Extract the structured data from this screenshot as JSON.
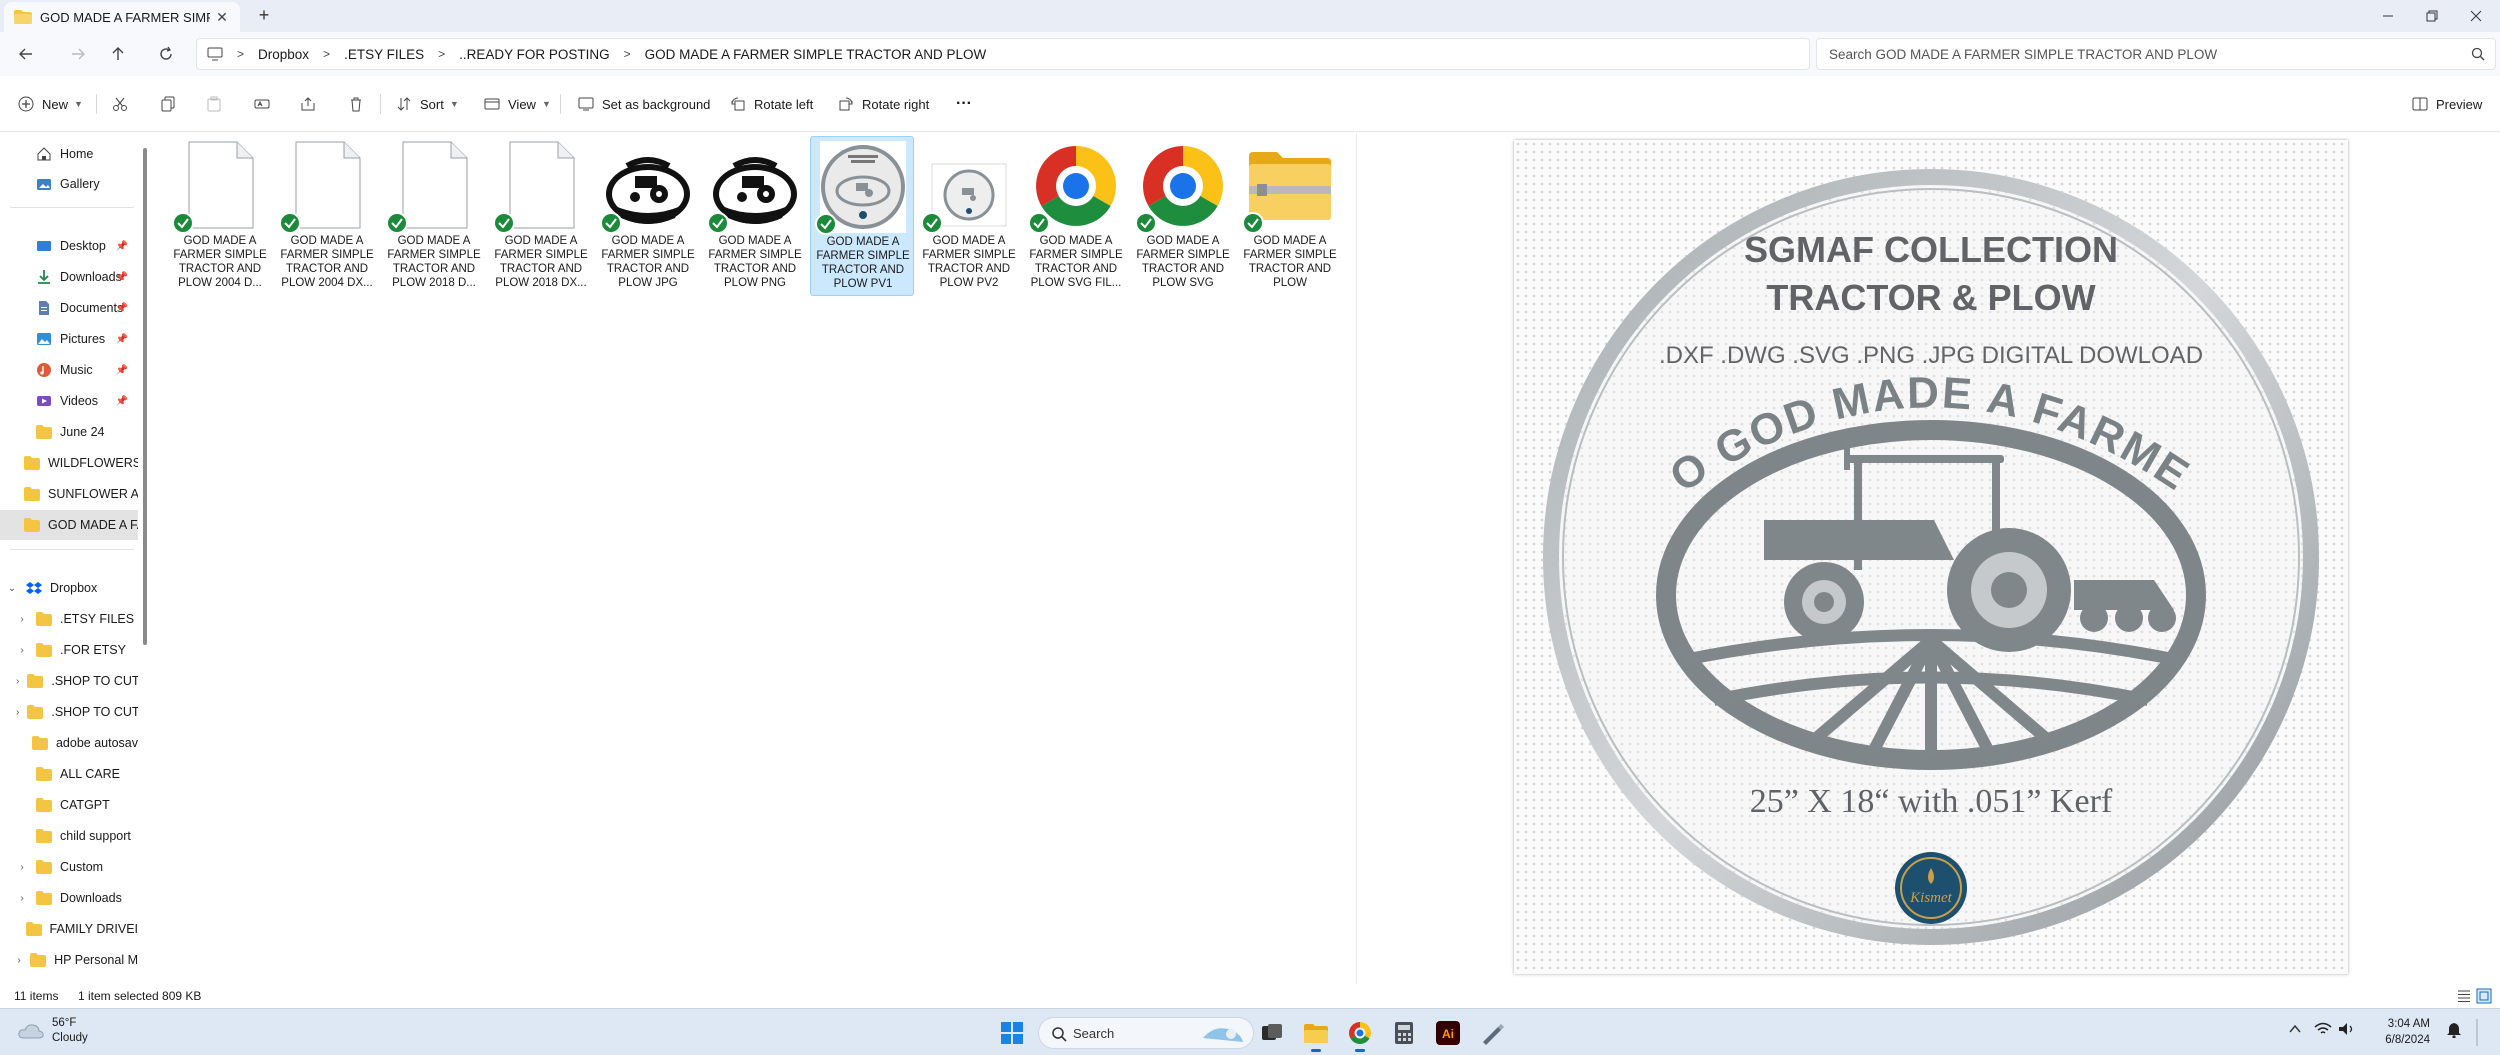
{
  "window": {
    "tab_title": "GOD MADE A FARMER SIMPLE",
    "new_tab": "+",
    "close": "✕"
  },
  "breadcrumbs": [
    "Dropbox",
    ".ETSY FILES",
    "..READY FOR POSTING",
    "GOD MADE A FARMER SIMPLE TRACTOR AND PLOW"
  ],
  "search": {
    "placeholder": "Search GOD MADE A FARMER SIMPLE TRACTOR AND PLOW"
  },
  "toolbar": {
    "new": "New",
    "sort": "Sort",
    "view": "View",
    "set_background": "Set as background",
    "rotate_left": "Rotate left",
    "rotate_right": "Rotate right",
    "more": "···",
    "preview": "Preview"
  },
  "sidebar": {
    "quick": [
      {
        "label": "Home",
        "icon": "home-icon"
      },
      {
        "label": "Gallery",
        "icon": "gallery-icon"
      }
    ],
    "pinned": [
      {
        "label": "Desktop",
        "icon": "desktop-icon",
        "pinned": true
      },
      {
        "label": "Downloads",
        "icon": "downloads-icon",
        "pinned": true
      },
      {
        "label": "Documents",
        "icon": "documents-icon",
        "pinned": true
      },
      {
        "label": "Pictures",
        "icon": "pictures-icon",
        "pinned": true
      },
      {
        "label": "Music",
        "icon": "music-icon",
        "pinned": true
      },
      {
        "label": "Videos",
        "icon": "videos-icon",
        "pinned": true
      },
      {
        "label": "June 24",
        "icon": "folder-icon",
        "pinned": false
      },
      {
        "label": "WILDFLOWERS I",
        "icon": "folder-icon",
        "pinned": false
      },
      {
        "label": "SUNFLOWER AL",
        "icon": "folder-icon",
        "pinned": false
      },
      {
        "label": "GOD MADE A FA",
        "icon": "folder-icon",
        "pinned": false,
        "selected": true
      }
    ],
    "dropbox_label": "Dropbox",
    "dropbox": [
      {
        "label": ".ETSY FILES",
        "expandable": true
      },
      {
        "label": ".FOR ETSY",
        "expandable": true
      },
      {
        "label": ".SHOP TO CUT",
        "expandable": true
      },
      {
        "label": ".SHOP TO CUT",
        "expandable": true
      },
      {
        "label": "adobe autosav",
        "expandable": false
      },
      {
        "label": "ALL CARE",
        "expandable": false
      },
      {
        "label": "CATGPT",
        "expandable": false
      },
      {
        "label": "child support",
        "expandable": false
      },
      {
        "label": "Custom",
        "expandable": true
      },
      {
        "label": "Downloads",
        "expandable": true
      },
      {
        "label": "FAMILY DRIVEI",
        "expandable": false
      },
      {
        "label": "HP Personal M",
        "expandable": true
      }
    ]
  },
  "files": [
    {
      "name": "GOD MADE A FARMER SIMPLE TRACTOR AND PLOW 2004 D...",
      "type": "blank",
      "synced": true
    },
    {
      "name": "GOD MADE A FARMER SIMPLE TRACTOR AND PLOW 2004 DX...",
      "type": "blank",
      "synced": true
    },
    {
      "name": "GOD MADE A FARMER SIMPLE TRACTOR AND PLOW 2018 D...",
      "type": "blank",
      "synced": true
    },
    {
      "name": "GOD MADE A FARMER SIMPLE TRACTOR AND PLOW 2018 DX...",
      "type": "blank",
      "synced": true
    },
    {
      "name": "GOD MADE A FARMER SIMPLE TRACTOR AND PLOW JPG",
      "type": "design-dark",
      "synced": true
    },
    {
      "name": "GOD MADE A FARMER SIMPLE TRACTOR AND PLOW PNG",
      "type": "design-dark",
      "synced": true
    },
    {
      "name": "GOD MADE A FARMER SIMPLE TRACTOR AND PLOW PV1",
      "type": "design-round",
      "synced": true,
      "selected": true
    },
    {
      "name": "GOD MADE A FARMER SIMPLE TRACTOR AND PLOW PV2",
      "type": "design-small",
      "synced": true
    },
    {
      "name": "GOD MADE A FARMER SIMPLE TRACTOR AND PLOW SVG FIL...",
      "type": "chrome",
      "synced": true
    },
    {
      "name": "GOD MADE A FARMER SIMPLE TRACTOR AND PLOW SVG",
      "type": "chrome",
      "synced": true
    },
    {
      "name": "GOD MADE A FARMER SIMPLE TRACTOR AND PLOW",
      "type": "zip",
      "synced": true
    }
  ],
  "preview": {
    "line1": "SGMAF COLLECTION",
    "line2": "TRACTOR & PLOW",
    "formats": ".DXF .DWG .SVG .PNG .JPG DIGITAL DOWLOAD",
    "arc_text": "SO GOD MADE A FARMER",
    "size": "25” X 18“ with .051” Kerf",
    "logo_text": "Kismet"
  },
  "status": {
    "count": "11 items",
    "selection": "1 item selected  809 KB"
  },
  "taskbar": {
    "weather_temp": "56°F",
    "weather_desc": "Cloudy",
    "search": "Search",
    "time": "3:04 AM",
    "date": "6/8/2024"
  },
  "colors": {
    "accent": "#0f6cbd",
    "folder": "#f4c542",
    "check": "#1b8a3a",
    "selected_item": "#cce8ff",
    "metal": "#8a9196"
  }
}
